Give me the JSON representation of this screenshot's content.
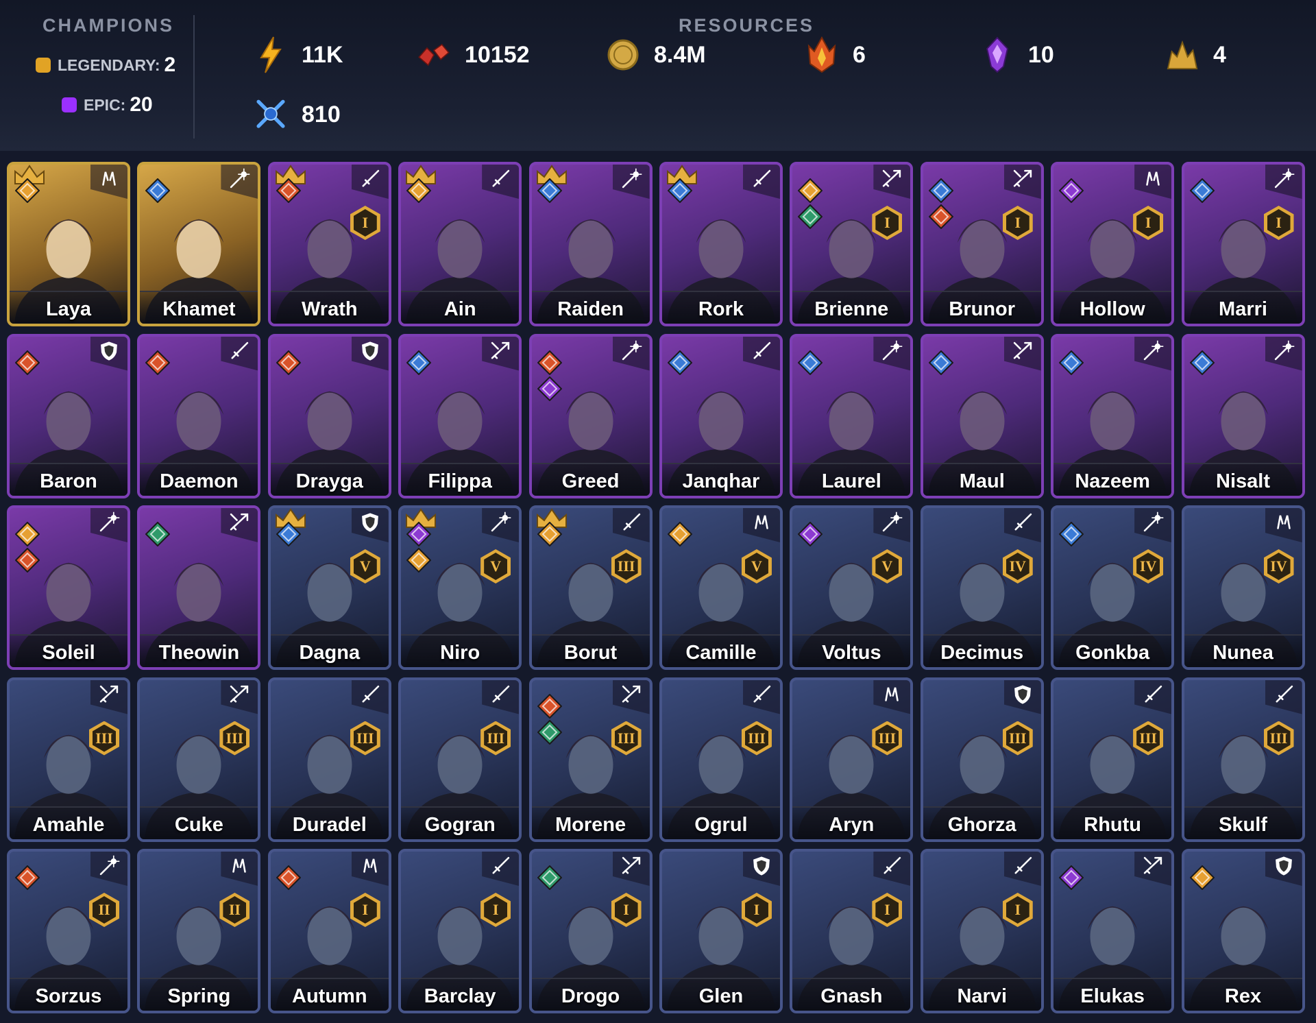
{
  "champions": {
    "title": "CHAMPIONS",
    "legendary_label": "LEGENDARY:",
    "legendary_count": "2",
    "epic_label": "EPIC:",
    "epic_count": "20"
  },
  "resources": {
    "title": "RESOURCES",
    "items": [
      {
        "icon": "energy-icon",
        "value": "11K"
      },
      {
        "icon": "rubies-icon",
        "value": "10152"
      },
      {
        "icon": "gold-coin-icon",
        "value": "8.4M"
      },
      {
        "icon": "fire-shard-icon",
        "value": "6"
      },
      {
        "icon": "void-shard-icon",
        "value": "10"
      },
      {
        "icon": "gold-pile-icon",
        "value": "4"
      },
      {
        "icon": "arena-token-icon",
        "value": "810"
      }
    ]
  },
  "colors": {
    "legendary": "#e1a325",
    "epic": "#9b30ff",
    "rare": "#47558a",
    "affinity": {
      "magic": "#3b7bd6",
      "force": "#d9532a",
      "spirit": "#2f9a6a",
      "void": "#8c3ad1",
      "dawn": "#e69a2a",
      "light": "#e6a032"
    }
  },
  "cards": [
    {
      "name": "Laya",
      "rarity": "legendary",
      "role": "support",
      "aff": [
        "light"
      ],
      "crown": true,
      "rank": ""
    },
    {
      "name": "Khamet",
      "rarity": "legendary",
      "role": "mage",
      "aff": [
        "magic"
      ],
      "crown": false,
      "rank": ""
    },
    {
      "name": "Wrath",
      "rarity": "epic",
      "role": "melee",
      "aff": [
        "force"
      ],
      "crown": true,
      "rank": "I"
    },
    {
      "name": "Ain",
      "rarity": "epic",
      "role": "melee",
      "aff": [
        "light"
      ],
      "crown": true,
      "rank": ""
    },
    {
      "name": "Raiden",
      "rarity": "epic",
      "role": "mage",
      "aff": [
        "magic"
      ],
      "crown": true,
      "rank": ""
    },
    {
      "name": "Rork",
      "rarity": "epic",
      "role": "melee",
      "aff": [
        "magic"
      ],
      "crown": true,
      "rank": ""
    },
    {
      "name": "Brienne",
      "rarity": "epic",
      "role": "ranged",
      "aff": [
        "light",
        "spirit"
      ],
      "crown": false,
      "rank": "I"
    },
    {
      "name": "Brunor",
      "rarity": "epic",
      "role": "ranged",
      "aff": [
        "magic",
        "force"
      ],
      "crown": false,
      "rank": "I"
    },
    {
      "name": "Hollow",
      "rarity": "epic",
      "role": "support",
      "aff": [
        "void"
      ],
      "crown": false,
      "rank": "I"
    },
    {
      "name": "Marri",
      "rarity": "epic",
      "role": "mage",
      "aff": [
        "magic"
      ],
      "crown": false,
      "rank": "I"
    },
    {
      "name": "Baron",
      "rarity": "epic",
      "role": "tank",
      "aff": [
        "force"
      ],
      "crown": false,
      "rank": ""
    },
    {
      "name": "Daemon",
      "rarity": "epic",
      "role": "melee",
      "aff": [
        "force"
      ],
      "crown": false,
      "rank": ""
    },
    {
      "name": "Drayga",
      "rarity": "epic",
      "role": "tank",
      "aff": [
        "force"
      ],
      "crown": false,
      "rank": ""
    },
    {
      "name": "Filippa",
      "rarity": "epic",
      "role": "ranged",
      "aff": [
        "magic"
      ],
      "crown": false,
      "rank": ""
    },
    {
      "name": "Greed",
      "rarity": "epic",
      "role": "mage",
      "aff": [
        "force",
        "void"
      ],
      "crown": false,
      "rank": ""
    },
    {
      "name": "Janqhar",
      "rarity": "epic",
      "role": "melee",
      "aff": [
        "magic"
      ],
      "crown": false,
      "rank": ""
    },
    {
      "name": "Laurel",
      "rarity": "epic",
      "role": "mage",
      "aff": [
        "magic"
      ],
      "crown": false,
      "rank": ""
    },
    {
      "name": "Maul",
      "rarity": "epic",
      "role": "ranged",
      "aff": [
        "magic"
      ],
      "crown": false,
      "rank": ""
    },
    {
      "name": "Nazeem",
      "rarity": "epic",
      "role": "mage",
      "aff": [
        "magic"
      ],
      "crown": false,
      "rank": ""
    },
    {
      "name": "Nisalt",
      "rarity": "epic",
      "role": "mage",
      "aff": [
        "magic"
      ],
      "crown": false,
      "rank": ""
    },
    {
      "name": "Soleil",
      "rarity": "epic",
      "role": "mage",
      "aff": [
        "light",
        "force"
      ],
      "crown": false,
      "rank": ""
    },
    {
      "name": "Theowin",
      "rarity": "epic",
      "role": "ranged",
      "aff": [
        "spirit"
      ],
      "crown": false,
      "rank": ""
    },
    {
      "name": "Dagna",
      "rarity": "rare",
      "role": "tank",
      "aff": [
        "magic"
      ],
      "crown": true,
      "rank": "V"
    },
    {
      "name": "Niro",
      "rarity": "rare",
      "role": "mage",
      "aff": [
        "void",
        "light"
      ],
      "crown": true,
      "rank": "V"
    },
    {
      "name": "Borut",
      "rarity": "rare",
      "role": "melee",
      "aff": [
        "light"
      ],
      "crown": true,
      "rank": "III"
    },
    {
      "name": "Camille",
      "rarity": "rare",
      "role": "support",
      "aff": [
        "light"
      ],
      "crown": false,
      "rank": "V"
    },
    {
      "name": "Voltus",
      "rarity": "rare",
      "role": "mage",
      "aff": [
        "void"
      ],
      "crown": false,
      "rank": "V"
    },
    {
      "name": "Decimus",
      "rarity": "rare",
      "role": "melee",
      "aff": [],
      "crown": false,
      "rank": "IV"
    },
    {
      "name": "Gonkba",
      "rarity": "rare",
      "role": "mage",
      "aff": [
        "magic"
      ],
      "crown": false,
      "rank": "IV"
    },
    {
      "name": "Nunea",
      "rarity": "rare",
      "role": "support",
      "aff": [],
      "crown": false,
      "rank": "IV"
    },
    {
      "name": "Amahle",
      "rarity": "rare",
      "role": "ranged",
      "aff": [],
      "crown": false,
      "rank": "III"
    },
    {
      "name": "Cuke",
      "rarity": "rare",
      "role": "ranged",
      "aff": [],
      "crown": false,
      "rank": "III"
    },
    {
      "name": "Duradel",
      "rarity": "rare",
      "role": "melee",
      "aff": [],
      "crown": false,
      "rank": "III"
    },
    {
      "name": "Gogran",
      "rarity": "rare",
      "role": "melee",
      "aff": [],
      "crown": false,
      "rank": "III"
    },
    {
      "name": "Morene",
      "rarity": "rare",
      "role": "ranged",
      "aff": [
        "force",
        "spirit"
      ],
      "crown": false,
      "rank": "III"
    },
    {
      "name": "Ogrul",
      "rarity": "rare",
      "role": "melee",
      "aff": [],
      "crown": false,
      "rank": "III"
    },
    {
      "name": "Aryn",
      "rarity": "rare",
      "role": "support",
      "aff": [],
      "crown": false,
      "rank": "III"
    },
    {
      "name": "Ghorza",
      "rarity": "rare",
      "role": "tank",
      "aff": [],
      "crown": false,
      "rank": "III"
    },
    {
      "name": "Rhutu",
      "rarity": "rare",
      "role": "melee",
      "aff": [],
      "crown": false,
      "rank": "III"
    },
    {
      "name": "Skulf",
      "rarity": "rare",
      "role": "melee",
      "aff": [],
      "crown": false,
      "rank": "III"
    },
    {
      "name": "Sorzus",
      "rarity": "rare",
      "role": "mage",
      "aff": [
        "force"
      ],
      "crown": false,
      "rank": "II"
    },
    {
      "name": "Spring",
      "rarity": "rare",
      "role": "support",
      "aff": [],
      "crown": false,
      "rank": "II"
    },
    {
      "name": "Autumn",
      "rarity": "rare",
      "role": "support",
      "aff": [
        "force"
      ],
      "crown": false,
      "rank": "I"
    },
    {
      "name": "Barclay",
      "rarity": "rare",
      "role": "melee",
      "aff": [],
      "crown": false,
      "rank": "I"
    },
    {
      "name": "Drogo",
      "rarity": "rare",
      "role": "ranged",
      "aff": [
        "spirit"
      ],
      "crown": false,
      "rank": "I"
    },
    {
      "name": "Glen",
      "rarity": "rare",
      "role": "tank",
      "aff": [],
      "crown": false,
      "rank": "I"
    },
    {
      "name": "Gnash",
      "rarity": "rare",
      "role": "melee",
      "aff": [],
      "crown": false,
      "rank": "I"
    },
    {
      "name": "Narvi",
      "rarity": "rare",
      "role": "melee",
      "aff": [],
      "crown": false,
      "rank": "I"
    },
    {
      "name": "Elukas",
      "rarity": "rare",
      "role": "ranged",
      "aff": [
        "void"
      ],
      "crown": false,
      "rank": ""
    },
    {
      "name": "Rex",
      "rarity": "rare",
      "role": "tank",
      "aff": [
        "light"
      ],
      "crown": false,
      "rank": ""
    }
  ]
}
